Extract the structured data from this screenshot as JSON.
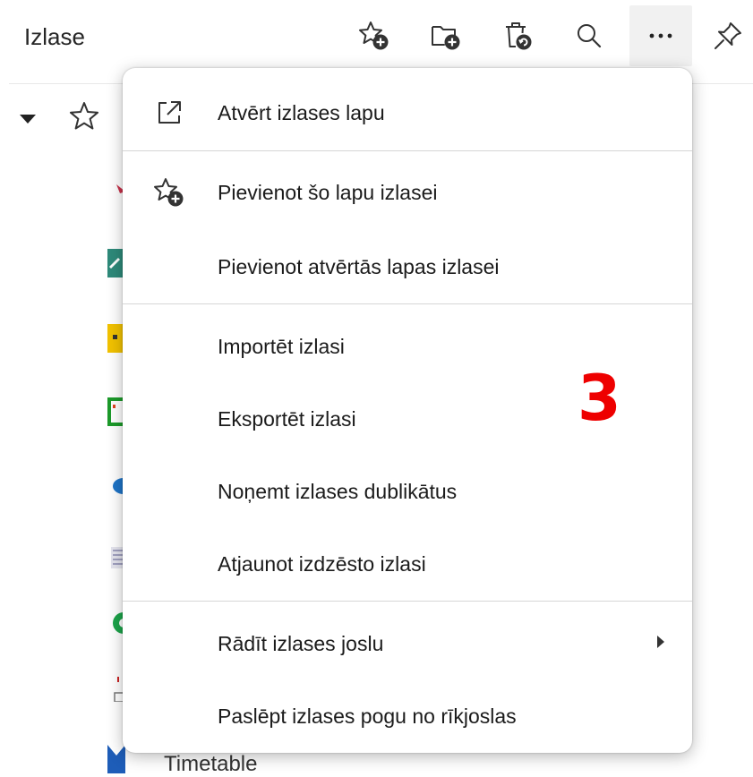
{
  "panel": {
    "title": "Izlase"
  },
  "toolbar": {
    "icons": [
      "add-favorite-icon",
      "add-folder-icon",
      "deleted-favorites-icon",
      "search-icon",
      "more-options-icon",
      "pin-icon"
    ],
    "more_label": "···"
  },
  "tree": {
    "folder_icon": "star-icon",
    "visible_item_label": "Timetable"
  },
  "menu": {
    "items": [
      {
        "label": "Atvērt izlases lapu",
        "icon": "open-external-icon"
      },
      {
        "label": "Pievienot šo lapu izlasei",
        "icon": "add-favorite-icon"
      },
      {
        "label": "Pievienot atvērtās lapas izlasei"
      },
      {
        "label": "Importēt izlasi"
      },
      {
        "label": "Eksportēt izlasi"
      },
      {
        "label": "Noņemt izlases dublikātus"
      },
      {
        "label": "Atjaunot izdzēsto izlasi"
      },
      {
        "label": "Rādīt izlases joslu",
        "submenu": true
      },
      {
        "label": "Paslēpt izlases pogu no rīkjoslas"
      }
    ]
  },
  "annotation": {
    "label": "3",
    "color": "#ee0000"
  },
  "colors": {
    "menu_background": "#ffffff",
    "separator": "#d6d6d6",
    "hover": "#f1f1f1",
    "annotation": "#ee0000"
  }
}
